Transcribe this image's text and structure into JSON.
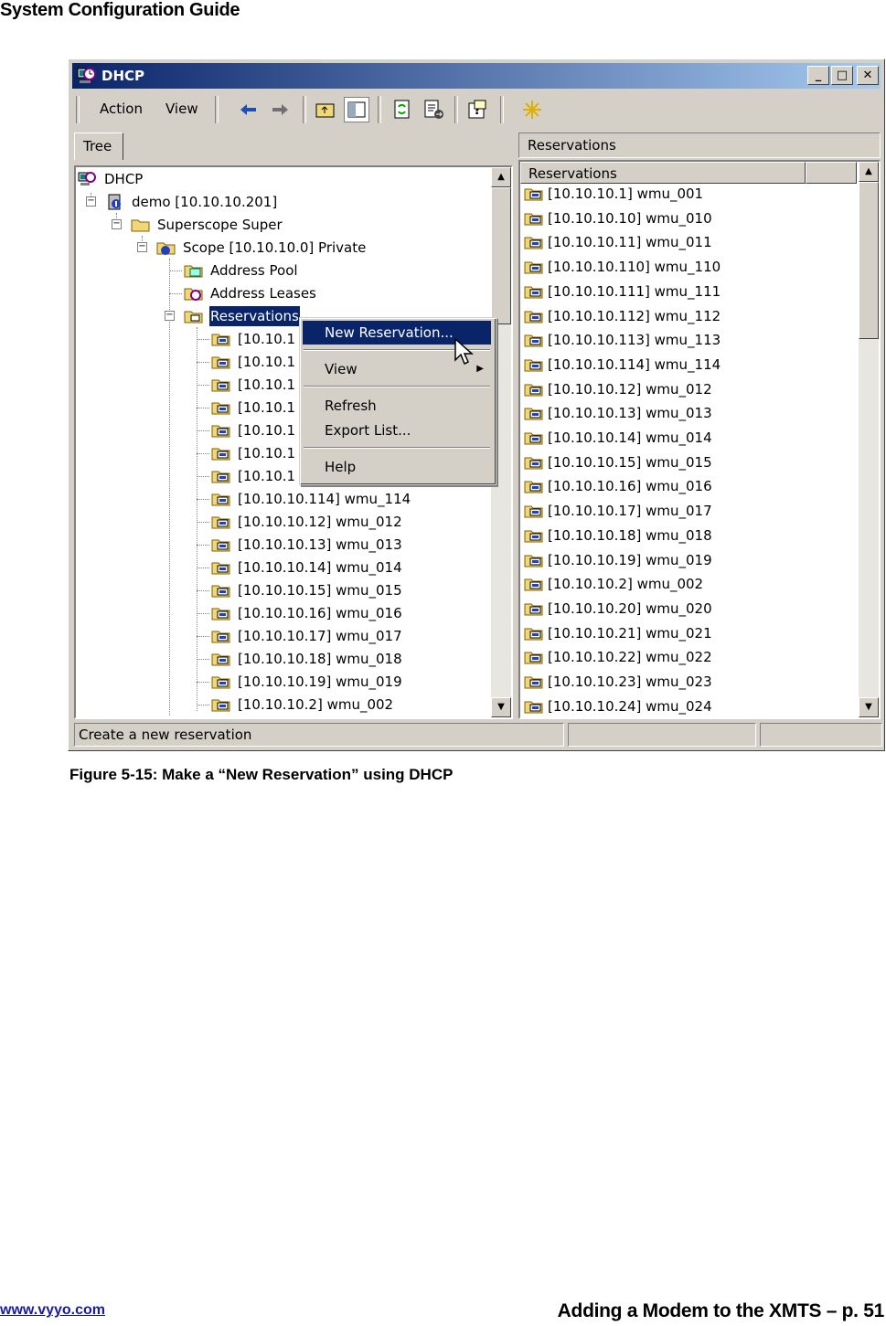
{
  "page": {
    "header": "System Configuration Guide",
    "footer_link": "www.vyyo.com",
    "footer_right": "Adding a Modem to the XMTS – p. 51",
    "caption": "Figure 5-15: Make a “New Reservation” using DHCP"
  },
  "window": {
    "title": "DHCP",
    "menus": [
      "Action",
      "View"
    ],
    "tab": "Tree",
    "right_header": "Reservations",
    "column_header": "Reservations",
    "status": "Create a new reservation"
  },
  "tree": {
    "root": "DHCP",
    "server": "demo [10.10.10.201]",
    "superscope": "Superscope Super",
    "scope": "Scope [10.10.10.0] Private",
    "address_pool": "Address Pool",
    "address_leases": "Address Leases",
    "reservations": "Reservations",
    "items": [
      "[10.10.1",
      "[10.10.1",
      "[10.10.1",
      "[10.10.1",
      "[10.10.1",
      "[10.10.1",
      "[10.10.1",
      "[10.10.10.114] wmu_114",
      "[10.10.10.12] wmu_012",
      "[10.10.10.13] wmu_013",
      "[10.10.10.14] wmu_014",
      "[10.10.10.15] wmu_015",
      "[10.10.10.16] wmu_016",
      "[10.10.10.17] wmu_017",
      "[10.10.10.18] wmu_018",
      "[10.10.10.19] wmu_019",
      "[10.10.10.2] wmu_002"
    ]
  },
  "list": [
    "[10.10.10.1] wmu_001",
    "[10.10.10.10] wmu_010",
    "[10.10.10.11] wmu_011",
    "[10.10.10.110] wmu_110",
    "[10.10.10.111] wmu_111",
    "[10.10.10.112] wmu_112",
    "[10.10.10.113] wmu_113",
    "[10.10.10.114] wmu_114",
    "[10.10.10.12] wmu_012",
    "[10.10.10.13] wmu_013",
    "[10.10.10.14] wmu_014",
    "[10.10.10.15] wmu_015",
    "[10.10.10.16] wmu_016",
    "[10.10.10.17] wmu_017",
    "[10.10.10.18] wmu_018",
    "[10.10.10.19] wmu_019",
    "[10.10.10.2] wmu_002",
    "[10.10.10.20] wmu_020",
    "[10.10.10.21] wmu_021",
    "[10.10.10.22] wmu_022",
    "[10.10.10.23] wmu_023",
    "[10.10.10.24] wmu_024"
  ],
  "context_menu": {
    "new_reservation": "New Reservation...",
    "view": "View",
    "refresh": "Refresh",
    "export_list": "Export List...",
    "help": "Help"
  },
  "icons": {
    "window": "dhcp-icon",
    "folder": "folder-icon",
    "reservation": "reservation-icon"
  },
  "colors": {
    "titlebar": "#0a246a",
    "selection": "#0a246a",
    "window_face": "#d4d0c8",
    "link": "#1a1a9c"
  }
}
